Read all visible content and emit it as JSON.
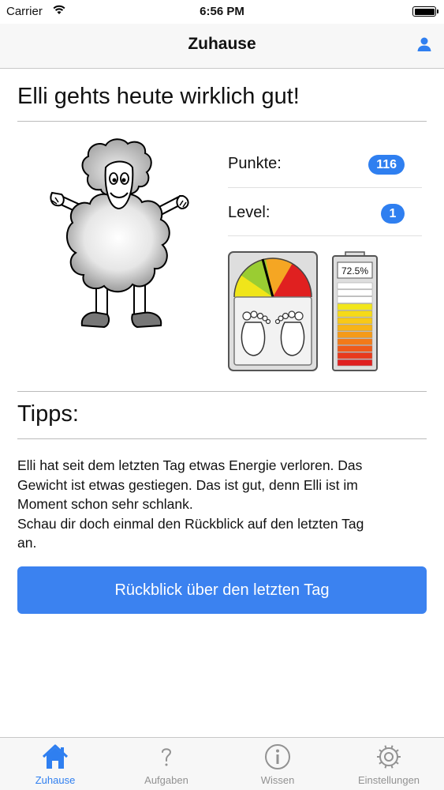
{
  "status_bar": {
    "carrier": "Carrier",
    "time": "6:56 PM"
  },
  "nav": {
    "title": "Zuhause",
    "user_icon": "user-icon"
  },
  "headline": "Elli gehts heute wirklich gut!",
  "stats": [
    {
      "label": "Punkte:",
      "value": "116"
    },
    {
      "label": "Level:",
      "value": "1"
    }
  ],
  "gauges": {
    "energy_label": "72.5%",
    "energy_fraction": 0.725
  },
  "tips": {
    "title": "Tipps:",
    "lines": [
      "Elli hat seit dem letzten Tag etwas Energie verloren. Das",
      "Gewicht ist etwas gestiegen. Das ist gut, denn Elli ist im",
      "Moment schon sehr schlank.",
      "Schau dir doch einmal den Rückblick auf den letzten Tag",
      "an."
    ]
  },
  "review_button": "Rückblick über den letzten Tag",
  "tabs": [
    {
      "label": "Zuhause",
      "icon": "home-icon",
      "active": true
    },
    {
      "label": "Aufgaben",
      "icon": "question-icon",
      "active": false
    },
    {
      "label": "Wissen",
      "icon": "info-icon",
      "active": false
    },
    {
      "label": "Einstellungen",
      "icon": "gear-icon",
      "active": false
    }
  ],
  "colors": {
    "accent": "#2f7ff0",
    "button": "#3b82f0",
    "tab_inactive": "#929292"
  }
}
